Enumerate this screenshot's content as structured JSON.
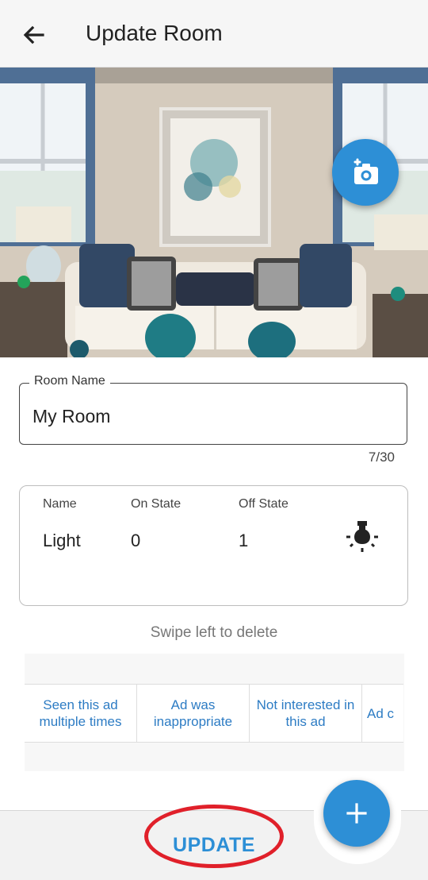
{
  "appbar": {
    "title": "Update Room"
  },
  "icons": {
    "back": "arrow-left-icon",
    "camera": "add-photo-camera-icon",
    "bulb": "light-bulb-icon",
    "add": "plus-icon"
  },
  "room_name": {
    "label": "Room Name",
    "value": "My Room",
    "counter": "7/30"
  },
  "device_table": {
    "headers": {
      "name": "Name",
      "on_state": "On State",
      "off_state": "Off State"
    },
    "row": {
      "name": "Light",
      "on_state": "0",
      "off_state": "1"
    }
  },
  "hint": "Swipe left to delete",
  "ad_options": [
    "Seen this ad multiple times",
    "Ad was inappropriate",
    "Not interested in this ad",
    "Ad c"
  ],
  "bottom": {
    "update_label": "UPDATE"
  },
  "colors": {
    "accent": "#2d8fd6",
    "highlight_ring": "#e0202a"
  }
}
